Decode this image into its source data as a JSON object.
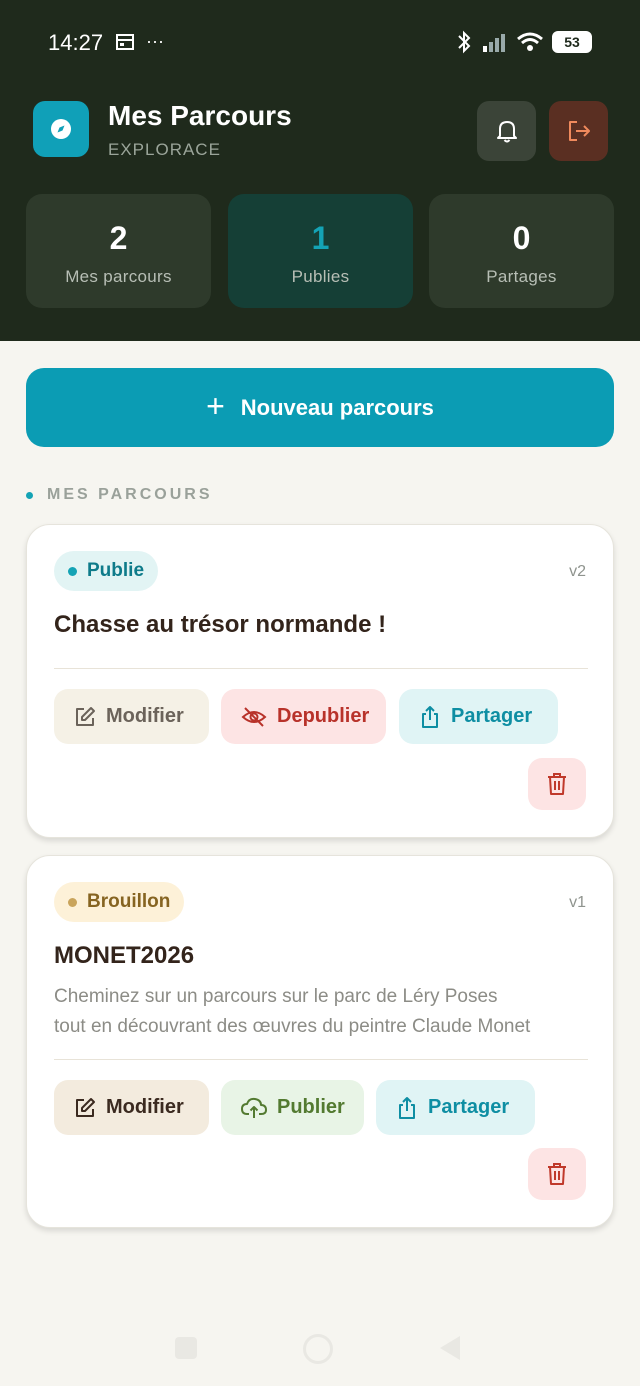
{
  "status_bar": {
    "time": "14:27",
    "more": "···",
    "battery": "53"
  },
  "header": {
    "title": "Mes Parcours",
    "subtitle": "EXPLORACE",
    "app_icon": "compass-icon",
    "bell_icon": "bell-icon",
    "logout_icon": "logout-icon"
  },
  "stats": [
    {
      "value": "2",
      "label": "Mes parcours"
    },
    {
      "value": "1",
      "label": "Publies"
    },
    {
      "value": "0",
      "label": "Partages"
    }
  ],
  "new_button": {
    "icon": "+",
    "label": "Nouveau parcours"
  },
  "section_label": "MES PARCOURS",
  "cards": [
    {
      "status": "Publie",
      "version": "v2",
      "title": "Chasse au trésor normande !",
      "actions": {
        "modify": "Modifier",
        "toggle": "Depublier",
        "share": "Partager"
      }
    },
    {
      "status": "Brouillon",
      "version": "v1",
      "title": "MONET2026",
      "description_line1": "Cheminez sur un parcours sur le parc de Léry Poses",
      "description_line2": "tout en découvrant des œuvres du peintre Claude Monet",
      "actions": {
        "modify": "Modifier",
        "toggle": "Publier",
        "share": "Partager"
      }
    }
  ],
  "colors": {
    "header_bg": "#1f2a1c",
    "accent": "#0b9cb4",
    "danger": "#b8322a",
    "success": "#537a31",
    "draft": "#866421"
  }
}
